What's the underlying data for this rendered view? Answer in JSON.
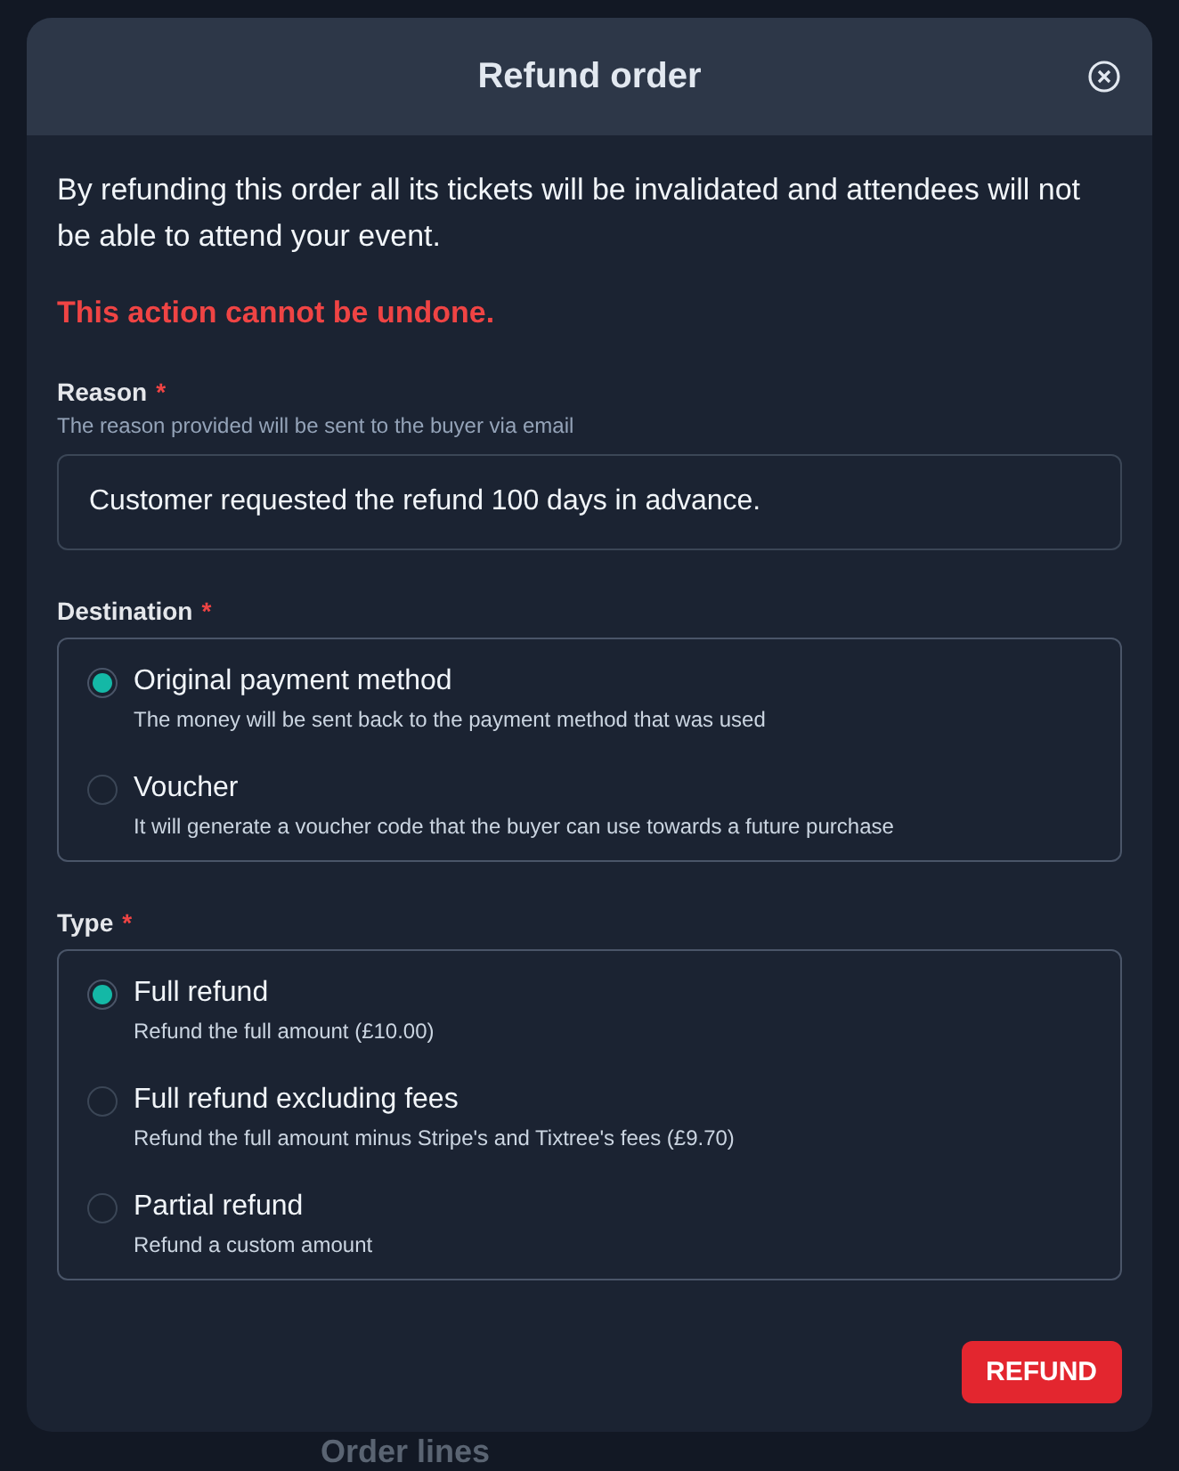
{
  "background": {
    "section": "Order lines"
  },
  "modal": {
    "title": "Refund order",
    "intro": "By refunding this order all its tickets will be invalidated and attendees will not be able to attend your event.",
    "warning": "This action cannot be undone.",
    "reason": {
      "label": "Reason",
      "required": "*",
      "hint": "The reason provided will be sent to the buyer via email",
      "value": "Customer requested the refund 100 days in advance."
    },
    "destination": {
      "label": "Destination",
      "required": "*",
      "options": [
        {
          "label": "Original payment method",
          "description": "The money will be sent back to the payment method that was used",
          "selected": true
        },
        {
          "label": "Voucher",
          "description": "It will generate a voucher code that the buyer can use towards a future purchase",
          "selected": false
        }
      ]
    },
    "type": {
      "label": "Type",
      "required": "*",
      "options": [
        {
          "label": "Full refund",
          "description": "Refund the full amount (£10.00)",
          "selected": true
        },
        {
          "label": "Full refund excluding fees",
          "description": "Refund the full amount minus Stripe's and Tixtree's fees (£9.70)",
          "selected": false
        },
        {
          "label": "Partial refund",
          "description": "Refund a custom amount",
          "selected": false
        }
      ]
    },
    "button": "REFUND"
  }
}
